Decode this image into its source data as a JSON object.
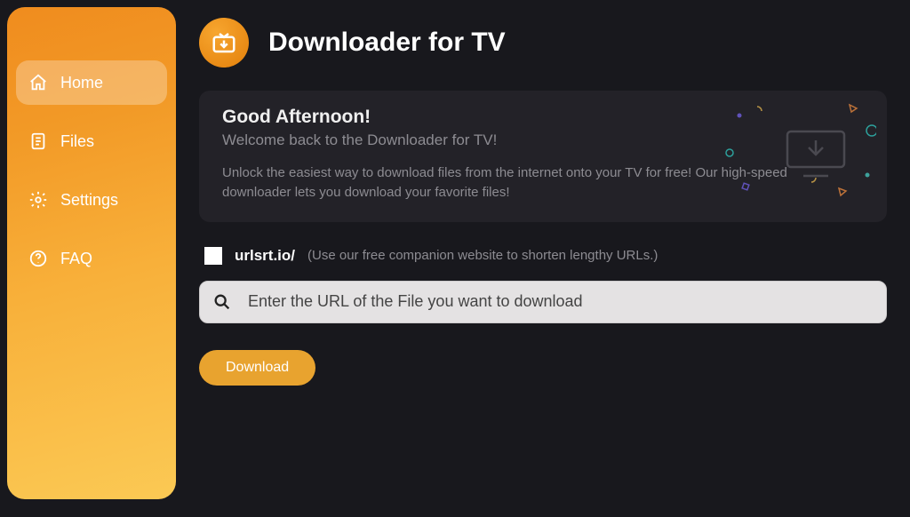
{
  "sidebar": {
    "items": [
      {
        "label": "Home",
        "icon": "home-icon",
        "active": true
      },
      {
        "label": "Files",
        "icon": "files-icon",
        "active": false
      },
      {
        "label": "Settings",
        "icon": "settings-icon",
        "active": false
      },
      {
        "label": "FAQ",
        "icon": "faq-icon",
        "active": false
      }
    ]
  },
  "header": {
    "app_title": "Downloader for TV"
  },
  "card": {
    "greeting": "Good Afternoon!",
    "welcome": "Welcome back to the Downloader for TV!",
    "description": "Unlock the easiest way to download files from the internet onto your TV for free! Our high-speed downloader lets you download your favorite files!"
  },
  "url_opt": {
    "prefix": "urlsrt.io/",
    "hint": "(Use our free companion website to shorten lengthy URLs.)",
    "checkbox_checked": false
  },
  "url_input": {
    "placeholder": "Enter the URL of the File you want to download",
    "value": ""
  },
  "download_button": {
    "label": "Download"
  },
  "colors": {
    "accent": "#e8a32f",
    "bg": "#18181d",
    "card": "#232228"
  }
}
